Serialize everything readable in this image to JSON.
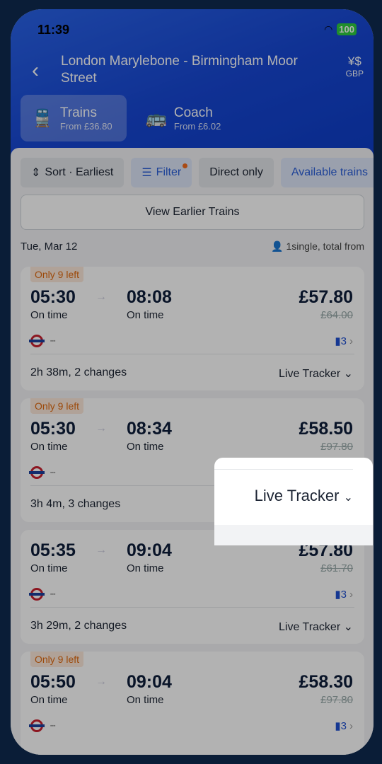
{
  "status": {
    "time": "11:39",
    "battery": "100"
  },
  "header": {
    "title": "London Marylebone - Birmingham Moor Street",
    "currency": "GBP"
  },
  "tabs": [
    {
      "label": "Trains",
      "sub": "From £36.80",
      "icon": "train-icon"
    },
    {
      "label": "Coach",
      "sub": "From £6.02",
      "icon": "bus-icon"
    }
  ],
  "chips": [
    "Sort · Earliest",
    "Filter",
    "Direct only",
    "Available trains"
  ],
  "earlier": "View Earlier Trains",
  "date": "Tue, Mar 12",
  "passengers": "1single, total from",
  "colors": {
    "accent": "#1f4fd1",
    "badge": "#e06a10"
  },
  "journeys": [
    {
      "badge": "Only 9 left",
      "dep": "05:30",
      "arr": "08:08",
      "dep_status": "On time",
      "arr_status": "On time",
      "price": "£57.80",
      "old": "£64.00",
      "duration": "2h 38m, 2 changes",
      "live": "Live Tracker"
    },
    {
      "badge": "Only 9 left",
      "dep": "05:30",
      "arr": "08:34",
      "dep_status": "On time",
      "arr_status": "On time",
      "price": "£58.50",
      "old": "£97.80",
      "duration": "3h 4m, 3 changes",
      "live": "Live Tracker"
    },
    {
      "badge": "",
      "dep": "05:35",
      "arr": "09:04",
      "dep_status": "On time",
      "arr_status": "On time",
      "price": "£57.80",
      "old": "£61.70",
      "duration": "3h 29m, 2 changes",
      "live": "Live Tracker"
    },
    {
      "badge": "Only 9 left",
      "dep": "05:50",
      "arr": "09:04",
      "dep_status": "On time",
      "arr_status": "On time",
      "price": "£58.30",
      "old": "£97.80",
      "duration": "",
      "live": ""
    }
  ],
  "spotlight": {
    "label": "Live Tracker"
  }
}
